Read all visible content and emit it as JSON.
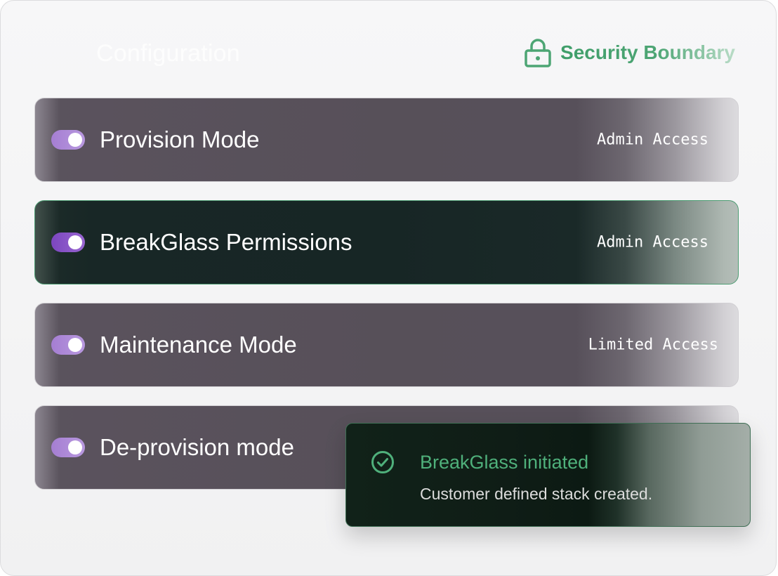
{
  "panel": {
    "title": "Configuration",
    "boundary": {
      "label": "Security Boundary",
      "icon": "lock-icon",
      "color": "#4da574"
    }
  },
  "rows": [
    {
      "label": "Provision Mode",
      "access": "Admin Access",
      "enabled": true,
      "highlighted": false
    },
    {
      "label": "BreakGlass Permissions",
      "access": "Admin Access",
      "enabled": true,
      "highlighted": true
    },
    {
      "label": "Maintenance Mode",
      "access": "Limited Access",
      "enabled": true,
      "highlighted": false
    },
    {
      "label": "De-provision mode",
      "access": "",
      "enabled": true,
      "highlighted": false
    }
  ],
  "toast": {
    "icon": "check-circle-icon",
    "title": "BreakGlass initiated",
    "message": "Customer defined stack created.",
    "color": "#4fb07b"
  },
  "colors": {
    "toggle_accent": "#9b6fd0",
    "row_background": "#57505a",
    "highlight_background": "#172625",
    "highlight_border": "#4c9c72"
  }
}
